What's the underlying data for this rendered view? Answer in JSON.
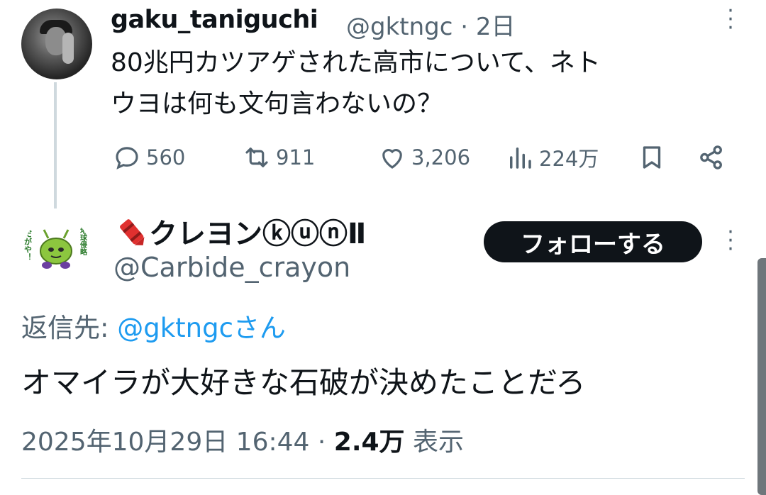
{
  "tweet1": {
    "display_name": "gaku_taniguchi",
    "handle_time": "@gktngc · 2日",
    "text_line1": "80兆円カツアゲされた高市について、ネト",
    "text_line2": "ウヨは何も文句言わないの？",
    "replies": "560",
    "reposts": "911",
    "likes": "3,206",
    "views": "224万"
  },
  "tweet2": {
    "display_name": "クレヨンⓚⓤⓝⅡ",
    "handle": "@Carbide_crayon",
    "follow_label": "フォローする",
    "reply_to_prefix": "返信先: ",
    "reply_to_mention": "@gktngcさん",
    "text": "オマイラが大好きな石破が決めたことだろ",
    "timestamp": "2025年10月29日 16:44 · ",
    "view_count": "2.4万",
    "view_label": " 表示",
    "avatar_text_left": "だがや！",
    "avatar_text_right": "地球侵略"
  },
  "icons": {
    "reply": "reply-icon",
    "repost": "repost-icon",
    "like": "like-icon",
    "views": "views-icon",
    "bookmark": "bookmark-icon",
    "share": "share-icon",
    "crayon": "crayon-icon",
    "more": "more-icon"
  },
  "colors": {
    "text": "#0f1419",
    "secondary": "#536471",
    "link": "#1d9bf0",
    "button": "#0f1419"
  }
}
